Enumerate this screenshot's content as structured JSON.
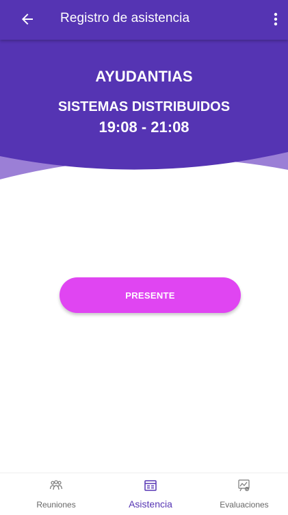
{
  "appbar": {
    "title": "Registro de asistencia",
    "back_icon": "arrow-back-icon",
    "menu_icon": "more-vert-icon",
    "color": "#5534b3"
  },
  "header": {
    "activity": "AYUDANTIAS",
    "course": "SISTEMAS DISTRIBUIDOS",
    "schedule": "19:08 - 21:08",
    "color": "#5534b3",
    "wave_color": "#9b7fd6"
  },
  "actions": {
    "present_label": "PRESENTE",
    "present_color": "#e045f2"
  },
  "bottom_nav": {
    "items": [
      {
        "label": "Reuniones",
        "icon": "people-group-icon",
        "active": false
      },
      {
        "label": "Asistencia",
        "icon": "attendance-list-icon",
        "active": true
      },
      {
        "label": "Evaluaciones",
        "icon": "evaluation-chart-icon",
        "active": false
      }
    ],
    "active_color": "#5534b3"
  }
}
